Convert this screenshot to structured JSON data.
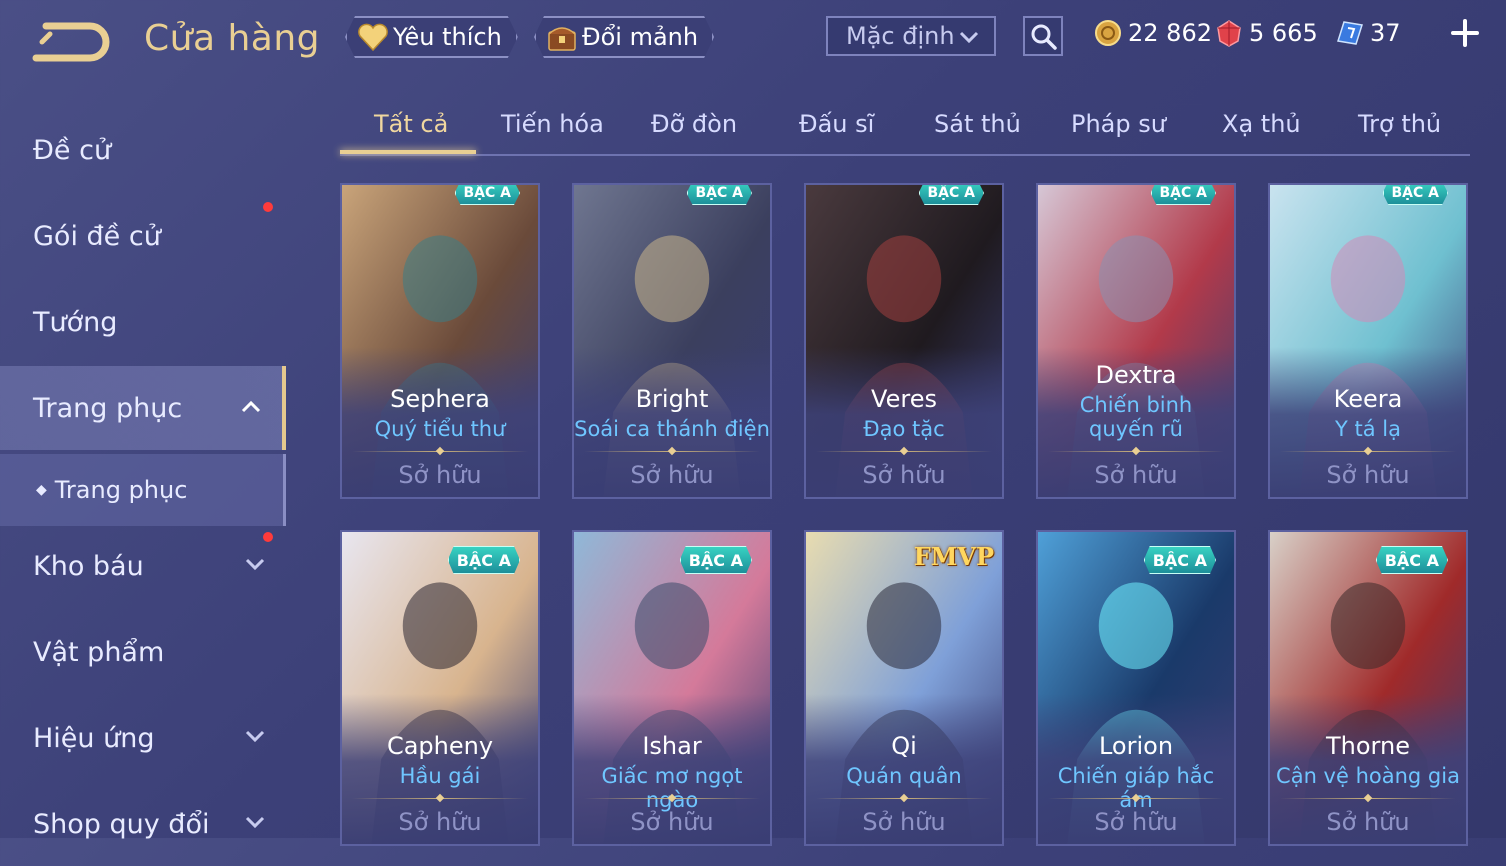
{
  "header": {
    "title": "Cửa hàng",
    "favorite_label": "Yêu thích",
    "exchange_label": "Đổi mảnh",
    "sort_value": "Mặc định"
  },
  "currencies": {
    "gold": "22 862",
    "ruby": "5 665",
    "ticket": "37"
  },
  "sidebar": {
    "items": [
      {
        "label": "Đề cử"
      },
      {
        "label": "Gói đề cử"
      },
      {
        "label": "Tướng"
      },
      {
        "label": "Trang phục"
      },
      {
        "label": "Trang phục"
      },
      {
        "label": "Kho báu"
      },
      {
        "label": "Vật phẩm"
      },
      {
        "label": "Hiệu ứng"
      },
      {
        "label": "Shop quy đổi"
      }
    ]
  },
  "tabs": [
    {
      "label": "Tất cả"
    },
    {
      "label": "Tiến hóa"
    },
    {
      "label": "Đỡ đòn"
    },
    {
      "label": "Đấu sĩ"
    },
    {
      "label": "Sát thủ"
    },
    {
      "label": "Pháp sư"
    },
    {
      "label": "Xạ thủ"
    },
    {
      "label": "Trợ thủ"
    }
  ],
  "cards": [
    {
      "badge": "BẬC A",
      "hero": "Sephera",
      "skin": "Quý tiểu thư",
      "status": "Sở hữu",
      "palette": [
        "#c9a47a",
        "#6a4a3a",
        "#3a7d86"
      ]
    },
    {
      "badge": "BẬC A",
      "hero": "Bright",
      "skin": "Soái ca thánh điện",
      "status": "Sở hữu",
      "palette": [
        "#6f7690",
        "#3b3f5e",
        "#c9b48a"
      ]
    },
    {
      "badge": "BẬC A",
      "hero": "Veres",
      "skin": "Đạo tặc",
      "status": "Sở hữu",
      "palette": [
        "#4a3a3e",
        "#1f1a1f",
        "#a04040"
      ]
    },
    {
      "badge": "BẬC A",
      "hero": "Dextra",
      "skin": "Chiến binh quyến rũ",
      "status": "Sở hữu",
      "palette": [
        "#d6c7d6",
        "#b23a4a",
        "#8a8fb0"
      ]
    },
    {
      "badge": "BẬC A",
      "hero": "Keera",
      "skin": "Y tá lạ",
      "status": "Sở hữu",
      "palette": [
        "#c9e3ef",
        "#6fc0d0",
        "#d28ab8"
      ]
    },
    {
      "badge": "BẬC A",
      "hero": "Capheny",
      "skin": "Hầu gái",
      "status": "Sở hữu",
      "palette": [
        "#e8e6f0",
        "#d8b48e",
        "#2a2430"
      ]
    },
    {
      "badge": "BẬC A",
      "hero": "Ishar",
      "skin": "Giấc mơ ngọt ngào",
      "status": "Sở hữu",
      "palette": [
        "#8fb8d8",
        "#d47a9a",
        "#3a4a6a"
      ]
    },
    {
      "badge": "FMVP",
      "hero": "Qi",
      "skin": "Quán quân",
      "status": "Sở hữu",
      "palette": [
        "#e8dcb0",
        "#7fa0d8",
        "#2a2a3a"
      ]
    },
    {
      "badge": "BẬC A",
      "hero": "Lorion",
      "skin": "Chiến giáp hắc ám",
      "status": "Sở hữu",
      "palette": [
        "#4fa0d8",
        "#1a3a6a",
        "#6ff0ff"
      ]
    },
    {
      "badge": "BẬC A",
      "hero": "Thorne",
      "skin": "Cận vệ hoàng gia",
      "status": "Sở hữu",
      "palette": [
        "#d8d0c8",
        "#a02a2a",
        "#3a2a2a"
      ]
    }
  ]
}
